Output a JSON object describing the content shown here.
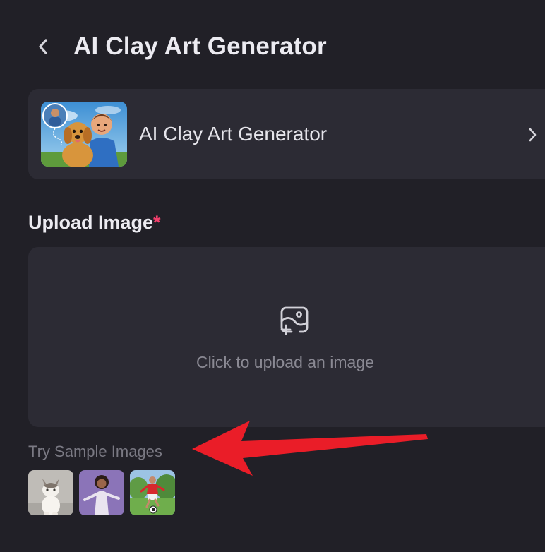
{
  "header": {
    "title": "AI Clay Art Generator",
    "back_icon": "chevron-left-icon"
  },
  "tool_card": {
    "name": "AI Clay Art Generator",
    "chevron_icon": "chevron-right-icon"
  },
  "upload": {
    "label": "Upload Image",
    "required_mark": "*",
    "prompt": "Click to upload an image",
    "icon": "image-add-icon"
  },
  "samples": {
    "label": "Try Sample Images",
    "items": [
      "cat",
      "girl",
      "soccer-boy"
    ]
  },
  "colors": {
    "background": "#212027",
    "card": "#2c2b34",
    "required": "#f23f6c",
    "annotation_arrow": "#ea1d28"
  }
}
